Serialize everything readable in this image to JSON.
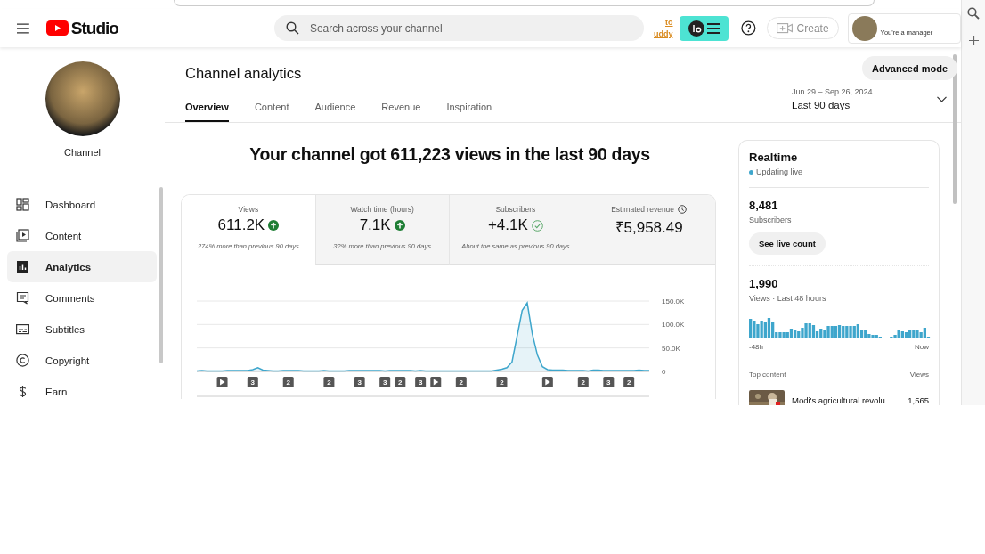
{
  "header": {
    "logo_text": "Studio",
    "search": {
      "placeholder": "Search across your channel"
    },
    "promo_link": "to uddy",
    "create_button": "Create",
    "account": {
      "role": "You're a manager"
    }
  },
  "sidebar": {
    "channel_label": "Channel",
    "items": [
      {
        "label": "Dashboard",
        "kind": "dashboard",
        "selected": false
      },
      {
        "label": "Content",
        "kind": "content",
        "selected": false
      },
      {
        "label": "Analytics",
        "kind": "analytics",
        "selected": true
      },
      {
        "label": "Comments",
        "kind": "comments",
        "selected": false
      },
      {
        "label": "Subtitles",
        "kind": "subtitles",
        "selected": false
      },
      {
        "label": "Copyright",
        "kind": "copyright",
        "selected": false
      },
      {
        "label": "Earn",
        "kind": "earn",
        "selected": false
      }
    ]
  },
  "analytics": {
    "title": "Channel analytics",
    "advanced_button": "Advanced mode",
    "tabs": [
      {
        "label": "Overview",
        "selected": true
      },
      {
        "label": "Content",
        "selected": false
      },
      {
        "label": "Audience",
        "selected": false
      },
      {
        "label": "Revenue",
        "selected": false
      },
      {
        "label": "Inspiration",
        "selected": false
      }
    ],
    "date_range": {
      "range": "Jun 29 – Sep 26, 2024",
      "label": "Last 90 days"
    },
    "headline": "Your channel got 611,223 views in the last 90 days",
    "metrics": [
      {
        "label": "Views",
        "value": "611.2K",
        "kind": "up",
        "note": "274% more than previous 90 days",
        "selected": true
      },
      {
        "label": "Watch time (hours)",
        "value": "7.1K",
        "kind": "up",
        "note": "32% more than previous 90 days",
        "selected": false
      },
      {
        "label": "Subscribers",
        "value": "+4.1K",
        "kind": "same",
        "note": "About the same as previous 90 days",
        "selected": false
      },
      {
        "label": "Estimated revenue",
        "value": "₹5,958.49",
        "kind": "pending",
        "selected": false
      }
    ],
    "chart_data": {
      "type": "area",
      "series": [
        {
          "color": "#3ea6cc",
          "values": [
            1000,
            2000,
            1000,
            1000,
            1000,
            1000,
            2000,
            2000,
            2000,
            2000,
            2000,
            4000,
            8000,
            3000,
            2000,
            1000,
            1000,
            2000,
            2000,
            2000,
            2000,
            1000,
            1000,
            1000,
            1000,
            2000,
            1000,
            1000,
            1000,
            1000,
            2000,
            2000,
            2000,
            2000,
            2000,
            2000,
            2000,
            1000,
            2000,
            2000,
            2000,
            2000,
            2000,
            1000,
            2000,
            1000,
            1000,
            1000,
            1000,
            1000,
            1000,
            1000,
            1000,
            1000,
            1000,
            1000,
            1000,
            1000,
            1000,
            3000,
            5000,
            8000,
            20000,
            75000,
            130000,
            146000,
            80000,
            35000,
            10000,
            4000,
            3000,
            3000,
            3000,
            2000,
            2000,
            2000,
            2000,
            1000,
            3000,
            3000,
            2000,
            2000,
            2000,
            2000,
            2000,
            2000,
            2000,
            3000,
            2000,
            2000
          ]
        }
      ],
      "ylim": [
        0,
        150000
      ],
      "yticks": [
        {
          "value": 0,
          "label": "0"
        },
        {
          "value": 50000,
          "label": "50.0K"
        },
        {
          "value": 100000,
          "label": "100.0K"
        },
        {
          "value": 150000,
          "label": "150.0K"
        }
      ]
    },
    "video_markers": [
      {
        "kind": "video"
      },
      {
        "kind": "count",
        "label": "3"
      },
      {
        "kind": "count",
        "label": "2"
      },
      {
        "kind": "count",
        "label": "2"
      },
      {
        "kind": "count",
        "label": "3"
      },
      {
        "kind": "count",
        "label": "3"
      },
      {
        "kind": "count",
        "label": "2"
      },
      {
        "kind": "count",
        "label": "3"
      },
      {
        "kind": "video"
      },
      {
        "kind": "count",
        "label": "2"
      },
      {
        "kind": "count",
        "label": "2"
      },
      {
        "kind": "video"
      },
      {
        "kind": "count",
        "label": "2"
      },
      {
        "kind": "count",
        "label": "3"
      },
      {
        "kind": "count",
        "label": "2"
      }
    ]
  },
  "realtime": {
    "title": "Realtime",
    "status": "Updating live",
    "subscribers": {
      "value": "8,481",
      "label": "Subscribers"
    },
    "live_button": "See live count",
    "views": {
      "value": "1,990",
      "label": "Views · Last 48 hours"
    },
    "axis_start": "-48h",
    "axis_end": "Now",
    "top_content": {
      "heading": "Top content",
      "views_heading": "Views",
      "items": [
        {
          "title": "Modi's agricultural revolu...",
          "views": "1,565"
        }
      ]
    }
  }
}
